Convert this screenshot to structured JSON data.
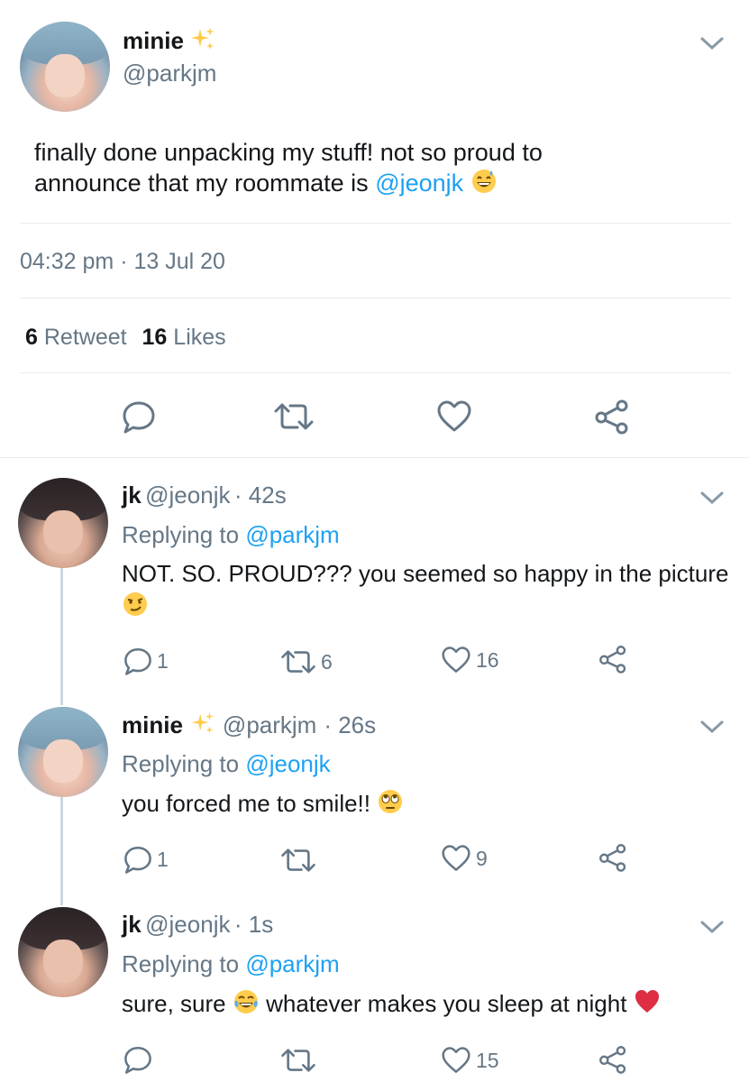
{
  "main_tweet": {
    "name": "minie",
    "handle": "@parkjm",
    "text_line1": "finally done unpacking my stuff! not so proud to",
    "text_line2_prefix": "announce that my roommate is ",
    "mention": "@jeonjk",
    "time": "04:32 pm",
    "separator": "·",
    "date": "13 Jul 20",
    "retweet_count": "6",
    "retweet_label": "Retweet",
    "like_count": "16",
    "like_label": "Likes"
  },
  "replies": [
    {
      "name": "jk",
      "handle": "@jeonjk",
      "time": "· 42s",
      "replying_label": "Replying to",
      "replying_to": "@parkjm",
      "text_line1": "NOT. SO. PROUD??? you seemed so happy in the picture",
      "reply_count": "1",
      "retweet_count": "6",
      "like_count": "16"
    },
    {
      "name": "minie",
      "handle": "@parkjm",
      "time": "· 26s",
      "replying_label": "Replying to",
      "replying_to": "@jeonjk",
      "text_line1": "you forced me to smile!!",
      "reply_count": "1",
      "retweet_count": "",
      "like_count": "9"
    },
    {
      "name": "jk",
      "handle": "@jeonjk",
      "time": "· 1s",
      "replying_label": "Replying to",
      "replying_to": "@parkjm",
      "text_part1": "sure, sure",
      "text_part2": "whatever makes you sleep at night",
      "reply_count": "",
      "retweet_count": "",
      "like_count": "15"
    }
  ],
  "colors": {
    "link": "#1da1f2",
    "muted": "#657786",
    "divider": "#e6ecf0",
    "thread_line": "#ccd6dd"
  },
  "icons": [
    "sparkles-icon",
    "chevron-down-icon",
    "reply-icon",
    "retweet-icon",
    "heart-icon",
    "share-icon",
    "grinning-sweat-emoji",
    "smirk-emoji",
    "eye-roll-emoji",
    "tears-of-joy-emoji",
    "red-heart-emoji"
  ]
}
